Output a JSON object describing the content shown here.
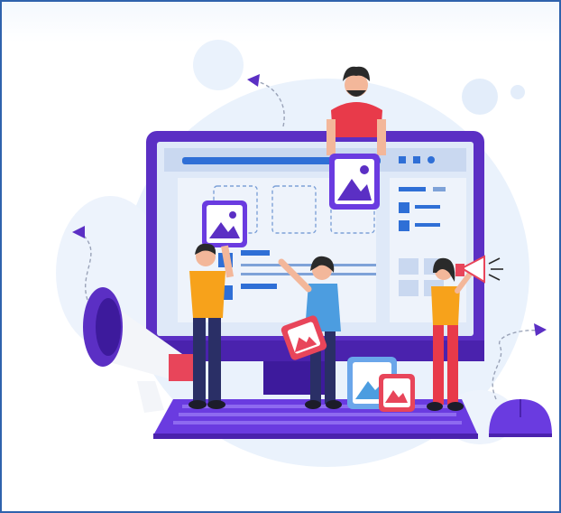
{
  "illustration": {
    "subject": "web-design-team",
    "colors": {
      "frame_border": "#2f62ad",
      "blob": "#eaf2fc",
      "monitor": "#5b2fc4",
      "monitor_dark": "#3d1a9c",
      "screen": "#dfe9f8",
      "accent_blue": "#2f6fd6",
      "accent_red": "#e8455a",
      "shirt_orange": "#f7a21b",
      "shirt_blue": "#4c9de0",
      "pants_red": "#e83a4a",
      "pants_navy": "#2a2f66"
    },
    "icons": [
      "image-icon",
      "megaphone-icon",
      "mouse-icon",
      "arrow-icon"
    ]
  }
}
